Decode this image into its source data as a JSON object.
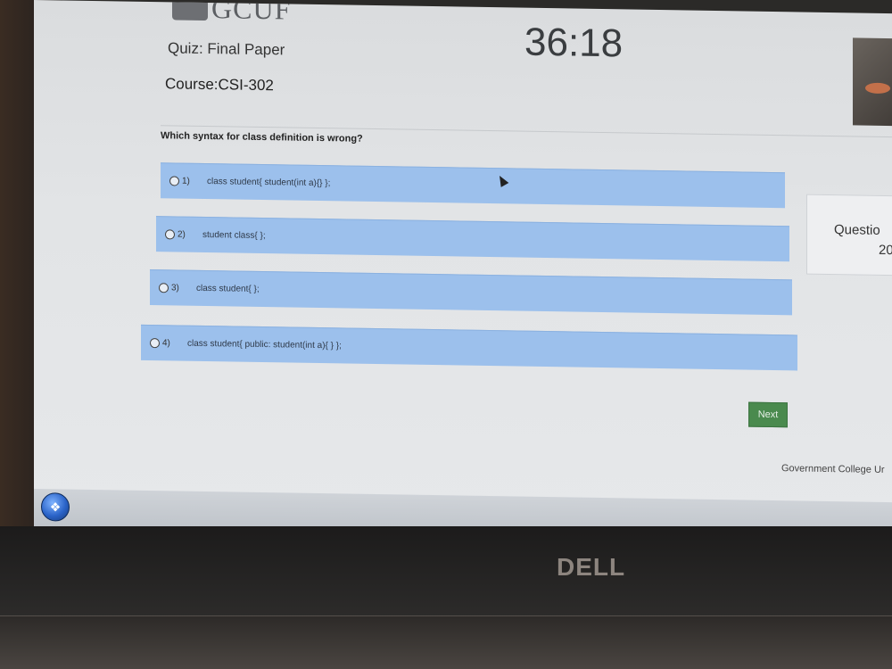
{
  "header": {
    "logo_text": "GCUF",
    "quiz_title": "Quiz: Final Paper",
    "course": "Course:CSI-302",
    "timer": "36:18"
  },
  "question": {
    "text": "Which syntax for class definition is wrong?",
    "options": [
      {
        "number": "1)",
        "text": "class student{ student(int a){} };"
      },
      {
        "number": "2)",
        "text": "student class{ };"
      },
      {
        "number": "3)",
        "text": "class student{ };"
      },
      {
        "number": "4)",
        "text": "class student{ public: student(int a){ } };"
      }
    ]
  },
  "navigation": {
    "next_label": "Next"
  },
  "side_panel": {
    "label": "Questio",
    "number": "20"
  },
  "footer": {
    "text": "Government College Ur"
  },
  "device": {
    "brand": "DELL"
  },
  "icons": {
    "start": "windows-start-orb-icon",
    "cursor": "mouse-pointer-icon"
  },
  "colors": {
    "option_bg": "#9cc0ec",
    "next_button": "#4a8a4e"
  }
}
